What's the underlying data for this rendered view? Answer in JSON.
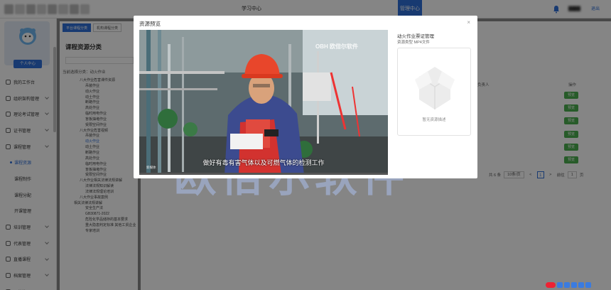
{
  "topbar": {
    "center_nav": "学习中心",
    "admin_tab": "管理中心",
    "logout": "退出"
  },
  "profile": {
    "button": "个人中心"
  },
  "sidebar": {
    "items": [
      {
        "label": "我的工作台",
        "chevron": false
      },
      {
        "label": "组织架构管理",
        "chevron": true
      },
      {
        "label": "理论考试管理",
        "chevron": true
      },
      {
        "label": "证书管理",
        "chevron": true
      },
      {
        "label": "课程管理",
        "chevron": true
      },
      {
        "label": "课程资源",
        "sub": true,
        "active": true
      },
      {
        "label": "课程制作",
        "sub": true
      },
      {
        "label": "课程分配",
        "sub": true
      },
      {
        "label": "开课管理",
        "sub": true
      },
      {
        "label": "培训管理",
        "chevron": true
      },
      {
        "label": "代表管理",
        "chevron": true
      },
      {
        "label": "直播课程",
        "chevron": true
      },
      {
        "label": "档案管理",
        "chevron": true
      },
      {
        "label": "运营管理",
        "chevron": true
      }
    ]
  },
  "panel": {
    "tabs": [
      "平台课程分类",
      "机构课程分类"
    ],
    "title": "课程资源分类",
    "current_prefix": "当前选择分类：",
    "current_value": "动火作业",
    "tree": [
      {
        "label": "八大作业危害课件资源",
        "level": 1
      },
      {
        "label": "吊装作业",
        "level": 2
      },
      {
        "label": "动火作业",
        "level": 2
      },
      {
        "label": "动土作业",
        "level": 2
      },
      {
        "label": "断路作业",
        "level": 2
      },
      {
        "label": "高处作业",
        "level": 2
      },
      {
        "label": "临时用电作业",
        "level": 2
      },
      {
        "label": "盲板抽堵作业",
        "level": 2
      },
      {
        "label": "受限空间作业",
        "level": 2
      },
      {
        "label": "八大作业危害视频",
        "level": 1
      },
      {
        "label": "吊装作业",
        "level": 2
      },
      {
        "label": "动火作业",
        "level": 2,
        "highlight": true
      },
      {
        "label": "动土作业",
        "level": 2
      },
      {
        "label": "断路作业",
        "level": 2
      },
      {
        "label": "高处作业",
        "level": 2
      },
      {
        "label": "临时用电作业",
        "level": 2
      },
      {
        "label": "盲板抽堵作业",
        "level": 2
      },
      {
        "label": "受限空间作业",
        "level": 2
      },
      {
        "label": "八大作业相关法律法规讲解",
        "level": 1
      },
      {
        "label": "法律法规知识解读",
        "level": 2
      },
      {
        "label": "法律法规理论培训",
        "level": 2
      },
      {
        "label": "八大作业事故案例",
        "level": 1
      },
      {
        "label": "相关法律法规讲解",
        "level": 0
      },
      {
        "label": "安全生产法",
        "level": 2
      },
      {
        "label": "GB30871-2022",
        "level": 2
      },
      {
        "label": "危险化学品储存的基本要求",
        "level": 2
      },
      {
        "label": "重大隐患判定标准 其他工贸企业",
        "level": 2
      },
      {
        "label": "专家培训",
        "level": 2
      }
    ]
  },
  "table": {
    "col_op": "操作",
    "col_person": "负责人",
    "preview_label": "预览",
    "preview_count": 6
  },
  "pagination": {
    "total": "共 6 条",
    "page_size": "10条/页",
    "prev": "<",
    "page": "1",
    "next": ">",
    "goto_prefix": "前往",
    "goto_value": "1",
    "goto_suffix": "页"
  },
  "modal": {
    "title": "资源预览",
    "close": "×",
    "resource_name": "动火作业票证管理",
    "resource_type": "资源类型 MP4文件",
    "no_cover": "暂无资源描述",
    "video": {
      "caption": "做好有毒有害气体以及可燃气体的检测工作",
      "logo": "OBH 欧倍尔软件",
      "tag": "新媒体",
      "progress_fraction": 0.0
    }
  },
  "watermark": "欧倍尔软件",
  "colors": {
    "primary": "#2f6fd8",
    "preview_button": "#4caf50",
    "profile_bg": "#e4ecf8"
  }
}
